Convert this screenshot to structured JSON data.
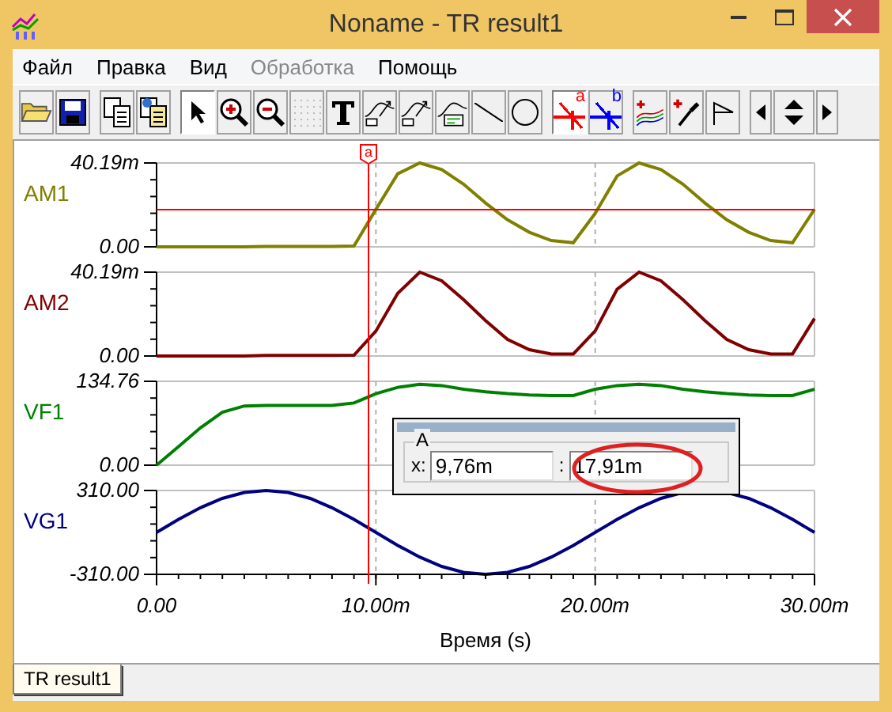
{
  "window": {
    "title": "Noname - TR result1"
  },
  "menu": [
    {
      "label": "Файл",
      "disabled": false
    },
    {
      "label": "Правка",
      "disabled": false
    },
    {
      "label": "Вид",
      "disabled": false
    },
    {
      "label": "Обработка",
      "disabled": true
    },
    {
      "label": "Помощь",
      "disabled": false
    }
  ],
  "toolbar": [
    [
      {
        "kind": "open",
        "pressed": false
      },
      {
        "kind": "save",
        "pressed": false
      }
    ],
    [
      {
        "kind": "copy",
        "pressed": false
      },
      {
        "kind": "paste",
        "pressed": false
      }
    ],
    [
      {
        "kind": "pointer",
        "pressed": true
      },
      {
        "kind": "zoom-in",
        "pressed": false
      },
      {
        "kind": "zoom-out",
        "pressed": false
      },
      {
        "kind": "grid",
        "pressed": false
      },
      {
        "kind": "text",
        "pressed": false
      },
      {
        "kind": "curve-label",
        "pressed": false
      },
      {
        "kind": "curve-query",
        "pressed": false
      },
      {
        "kind": "curve-table",
        "pressed": false
      },
      {
        "kind": "line",
        "pressed": false
      },
      {
        "kind": "circle",
        "pressed": false
      }
    ],
    [
      {
        "kind": "cursor",
        "label": "a",
        "color": "#ff0000",
        "pressed": true
      },
      {
        "kind": "cursor",
        "label": "b",
        "color": "#0000ff",
        "pressed": false
      }
    ],
    [
      {
        "kind": "add-curves",
        "pressed": false
      },
      {
        "kind": "add-probe",
        "pressed": false
      },
      {
        "kind": "flag",
        "pressed": false
      }
    ],
    [
      {
        "kind": "left",
        "pressed": false
      },
      {
        "kind": "updown",
        "pressed": false
      },
      {
        "kind": "right",
        "pressed": false
      }
    ]
  ],
  "cursor": {
    "label": "a"
  },
  "panels": [
    {
      "chart_data": {
        "type": "line",
        "x": [
          0,
          1,
          2,
          3,
          4,
          5,
          6,
          7,
          8,
          9,
          10,
          11,
          12,
          13,
          14,
          15,
          16,
          17,
          18,
          19,
          20,
          21,
          22,
          23,
          24,
          25,
          26,
          27,
          28,
          29,
          30
        ],
        "xlim": [
          0,
          30
        ],
        "ylim": [
          0,
          40.19
        ],
        "yticks": [
          {
            "value": 0,
            "label": "0.00"
          },
          {
            "value": 40.19,
            "label": "40.19m"
          }
        ],
        "series": [
          {
            "name": "AM1",
            "color": "#808000",
            "values": [
              0,
              0,
              0,
              0,
              0,
              0.2,
              0.2,
              0.2,
              0.2,
              0.4,
              18,
              35,
              40.19,
              37,
              30,
              21,
              13,
              7,
              3,
              2,
              16,
              34,
              40.19,
              37,
              30,
              21,
              13,
              7,
              3,
              2,
              18
            ]
          }
        ]
      }
    },
    {
      "chart_data": {
        "type": "line",
        "x": [
          0,
          1,
          2,
          3,
          4,
          5,
          6,
          7,
          8,
          9,
          10,
          11,
          12,
          13,
          14,
          15,
          16,
          17,
          18,
          19,
          20,
          21,
          22,
          23,
          24,
          25,
          26,
          27,
          28,
          29,
          30
        ],
        "xlim": [
          0,
          30
        ],
        "ylim": [
          0,
          40.19
        ],
        "yticks": [
          {
            "value": 0,
            "label": "0.00"
          },
          {
            "value": 40.19,
            "label": "40.19m"
          }
        ],
        "series": [
          {
            "name": "AM2",
            "color": "#800000",
            "values": [
              0,
              0,
              0,
              0,
              0,
              0.3,
              0.3,
              0.3,
              0.3,
              0.4,
              12,
              30,
              40.19,
              36,
              27,
              17,
              8,
              3,
              1,
              1,
              12,
              32,
              40.19,
              36,
              27,
              17,
              8,
              3,
              1,
              1,
              18
            ]
          }
        ]
      }
    },
    {
      "chart_data": {
        "type": "line",
        "x": [
          0,
          1,
          2,
          3,
          4,
          5,
          6,
          7,
          8,
          9,
          10,
          11,
          12,
          13,
          14,
          15,
          16,
          17,
          18,
          19,
          20,
          21,
          22,
          23,
          24,
          25,
          26,
          27,
          28,
          29,
          30
        ],
        "xlim": [
          0,
          30
        ],
        "ylim": [
          0,
          134.76
        ],
        "yticks": [
          {
            "value": 0,
            "label": "0.00"
          },
          {
            "value": 134.76,
            "label": "134.76"
          }
        ],
        "series": [
          {
            "name": "VF1",
            "color": "#008000",
            "values": [
              0,
              30,
              60,
              85,
              95,
              96,
              96,
              96,
              96,
              100,
              115,
              125,
              130,
              128,
              122,
              118,
              115,
              113,
              112,
              112,
              122,
              128,
              130,
              128,
              122,
              118,
              115,
              113,
              112,
              112,
              122
            ]
          }
        ]
      }
    },
    {
      "chart_data": {
        "type": "line",
        "x": [
          0,
          1,
          2,
          3,
          4,
          5,
          6,
          7,
          8,
          9,
          10,
          11,
          12,
          13,
          14,
          15,
          16,
          17,
          18,
          19,
          20,
          21,
          22,
          23,
          24,
          25,
          26,
          27,
          28,
          29,
          30
        ],
        "xlim": [
          0,
          30
        ],
        "ylim": [
          -310,
          310
        ],
        "yticks": [
          {
            "value": -310,
            "label": "-310.00"
          },
          {
            "value": 310,
            "label": "310.00"
          }
        ],
        "xticks": [
          {
            "value": 0,
            "label": "0.00"
          },
          {
            "value": 10,
            "label": "10.00m"
          },
          {
            "value": 20,
            "label": "20.00m"
          },
          {
            "value": 30,
            "label": "30.00m"
          }
        ],
        "xlabel": "Время (s)",
        "series": [
          {
            "name": "VG1",
            "color": "#000080",
            "values": [
              0,
              96,
              182,
              251,
              295,
              310,
              295,
              251,
              182,
              96,
              0,
              -96,
              -182,
              -251,
              -295,
              -310,
              -295,
              -251,
              -182,
              -96,
              0,
              96,
              182,
              251,
              295,
              null,
              295,
              251,
              182,
              96,
              0
            ]
          }
        ]
      }
    }
  ],
  "cursor_box": {
    "group": "A",
    "x_label": "x:",
    "x_value": "9,76m",
    "y_label": ":",
    "y_value": "17,91m"
  },
  "tabs": [
    {
      "label": "TR result1",
      "selected": true
    }
  ]
}
